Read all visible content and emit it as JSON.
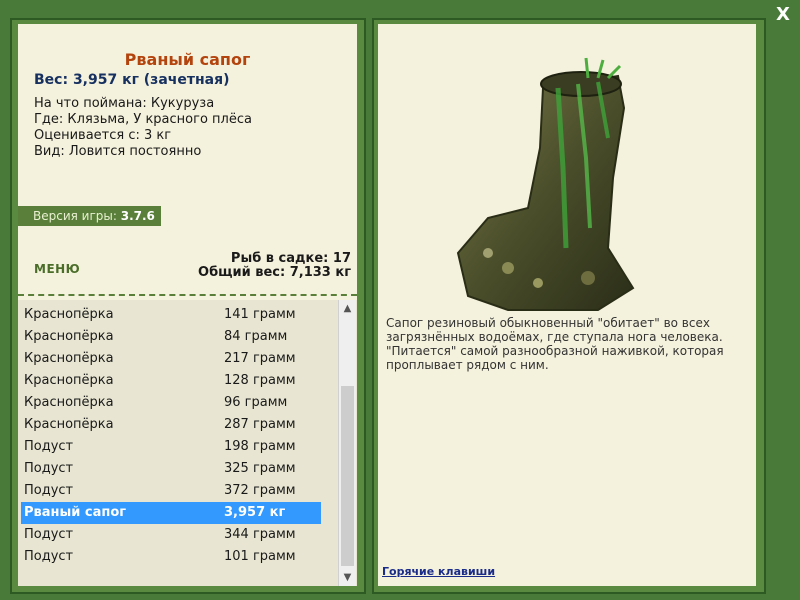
{
  "fish": {
    "title": "Рваный сапог",
    "weight": "Вес: 3,957 кг (зачетная)",
    "caught_on": "На что поймана: Кукуруза",
    "where": "Где: Клязьма, У красного плёса",
    "rated_from": "Оценивается с: 3 кг",
    "kind": "Вид: Ловится постоянно",
    "description_lines": [
      "Сапог резиновый обыкновенный \"обитает\" во всех",
      "загрязнённых водоёмах, где ступала нога человека.",
      "\"Питается\" самой разнообразной наживкой, которая",
      "проплывает рядом с ним."
    ]
  },
  "version": {
    "label": "Версия игры:",
    "value": "3.7.6"
  },
  "menu_label": "МЕНЮ",
  "cage": {
    "count_label": "Рыб в садке: 17",
    "total_weight_label": "Общий вес: 7,133 кг"
  },
  "catch_list": [
    {
      "name": "Краснопёрка",
      "weight": "141 грамм"
    },
    {
      "name": "Краснопёрка",
      "weight": "84 грамм"
    },
    {
      "name": "Краснопёрка",
      "weight": "217 грамм"
    },
    {
      "name": "Краснопёрка",
      "weight": "128 грамм"
    },
    {
      "name": "Краснопёрка",
      "weight": "96 грамм"
    },
    {
      "name": "Краснопёрка",
      "weight": "287 грамм"
    },
    {
      "name": "Подуст",
      "weight": "198 грамм"
    },
    {
      "name": "Подуст",
      "weight": "325 грамм"
    },
    {
      "name": "Подуст",
      "weight": "372 грамм"
    },
    {
      "name": "Рваный сапог",
      "weight": "3,957 кг",
      "selected": true
    },
    {
      "name": "Подуст",
      "weight": "344 грамм"
    },
    {
      "name": "Подуст",
      "weight": "101 грамм"
    }
  ],
  "hotkeys_label": "Горячие клавиши",
  "close_label": "X",
  "colors": {
    "background": "#4a7a3a",
    "panel": "#f4f1dc",
    "title": "#b4440e",
    "weight": "#16305f",
    "selected_row": "#3399ff"
  }
}
